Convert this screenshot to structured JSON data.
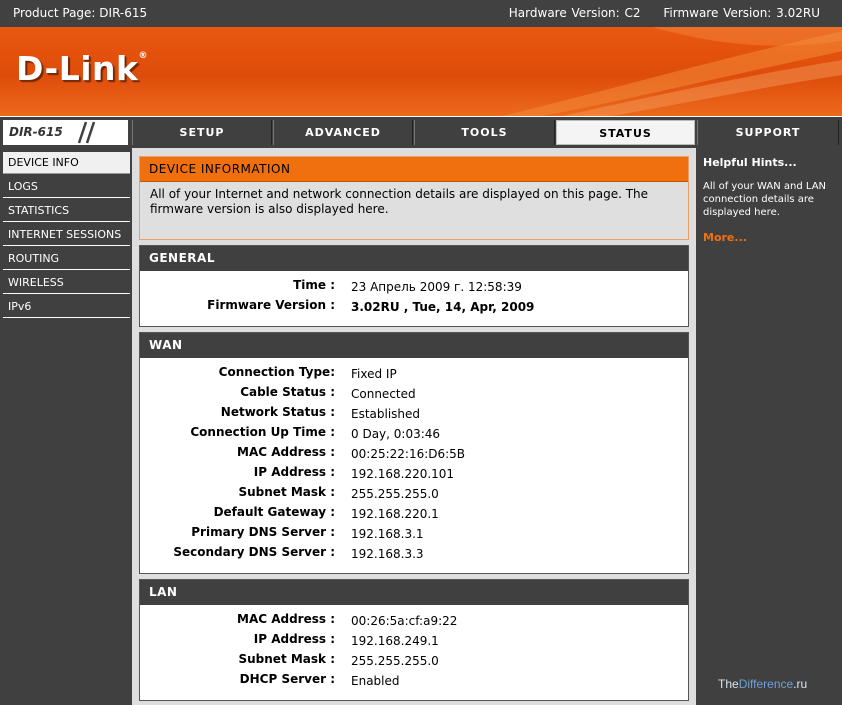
{
  "topbar": {
    "product": "Product Page: DIR-615",
    "hardware": "Hardware Version: C2",
    "firmware": "Firmware Version: 3.02RU"
  },
  "brand": {
    "logo": "D-Link",
    "reg": "®",
    "model": "DIR-615"
  },
  "tabs": [
    "SETUP",
    "ADVANCED",
    "TOOLS",
    "STATUS",
    "SUPPORT"
  ],
  "active_tab": "STATUS",
  "leftnav": [
    "DEVICE INFO",
    "LOGS",
    "STATISTICS",
    "INTERNET SESSIONS",
    "ROUTING",
    "WIRELESS",
    "IPv6"
  ],
  "device_info": {
    "title": "DEVICE INFORMATION",
    "desc": "All of your Internet and network connection details are displayed on this page. The firmware version is also displayed here."
  },
  "general": {
    "title": "GENERAL",
    "rows": [
      {
        "label": "Time :",
        "value": "23 Апрель 2009 г. 12:58:39"
      },
      {
        "label": "Firmware Version :",
        "value": "3.02RU , Tue, 14, Apr, 2009"
      }
    ]
  },
  "wan": {
    "title": "WAN",
    "rows": [
      {
        "label": "Connection Type:",
        "value": "Fixed IP"
      },
      {
        "label": "Cable Status :",
        "value": "Connected"
      },
      {
        "label": "Network Status :",
        "value": "Established"
      },
      {
        "label": "Connection Up Time :",
        "value": "0 Day, 0:03:46"
      },
      {
        "label": "MAC Address :",
        "value": "00:25:22:16:D6:5B"
      },
      {
        "label": "IP Address :",
        "value": "192.168.220.101"
      },
      {
        "label": "Subnet Mask :",
        "value": "255.255.255.0"
      },
      {
        "label": "Default Gateway :",
        "value": "192.168.220.1"
      },
      {
        "label": "Primary DNS Server :",
        "value": "192.168.3.1"
      },
      {
        "label": "Secondary DNS Server :",
        "value": "192.168.3.3"
      }
    ]
  },
  "lan": {
    "title": "LAN",
    "rows": [
      {
        "label": "MAC Address :",
        "value": "00:26:5a:cf:a9:22"
      },
      {
        "label": "IP Address :",
        "value": "192.168.249.1"
      },
      {
        "label": "Subnet Mask :",
        "value": "255.255.255.0"
      },
      {
        "label": "DHCP Server :",
        "value": "Enabled"
      }
    ]
  },
  "hints": {
    "title": "Helpful Hints...",
    "text": "All of your WAN and LAN connection details are displayed here.",
    "more": "More..."
  },
  "watermark": {
    "part1": "The",
    "part2": "Difference",
    "part3": ".ru"
  },
  "colors": {
    "accent": "#f07010",
    "dark": "#404040",
    "banner": "#e0500c"
  }
}
